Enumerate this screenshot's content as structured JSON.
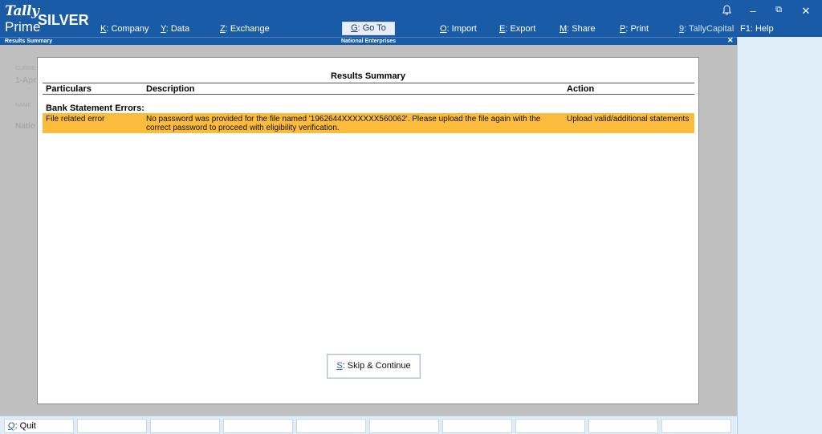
{
  "app": {
    "logo_top": "Tally",
    "logo_bottom": "Prime",
    "edition": "SILVER"
  },
  "menu": [
    {
      "key": "K",
      "label": ": Company"
    },
    {
      "key": "Y",
      "label": ": Data"
    },
    {
      "key": "Z",
      "label": ": Exchange"
    },
    {
      "key": "G",
      "label": ": Go To"
    },
    {
      "key": "O",
      "label": ": Import"
    },
    {
      "key": "E",
      "label": ": Export"
    },
    {
      "key": "M",
      "label": ": Share"
    },
    {
      "key": "P",
      "label": ": Print"
    },
    {
      "key": "9",
      "label": ": TallyCapital"
    },
    {
      "key": "F1",
      "label": ": Help"
    }
  ],
  "window_controls": {
    "bell": "bell-icon",
    "minimize": "–",
    "restore": "⧉",
    "close": "✕"
  },
  "strip": {
    "screen_title": "Results Summary",
    "company": "National Enterprises",
    "close": "✕"
  },
  "background_ghost": {
    "label1": "CURRE",
    "date": "1-Apr",
    "label2": "NAME",
    "company_partial": "Natio"
  },
  "modal": {
    "title": "Results Summary",
    "columns": {
      "particulars": "Particulars",
      "description": "Description",
      "action": "Action"
    },
    "section_heading": "Bank Statement Errors:",
    "rows": [
      {
        "particulars": "File related error",
        "description": "No password was provided for the file named '1962644XXXXXXX560062'. Please upload the file again with the correct password to proceed with eligibility verification.",
        "action": "Upload valid/additional statements"
      }
    ],
    "button": {
      "key": "S",
      "label": ": Skip & Continue"
    }
  },
  "bottombar": {
    "quit_key": "Q",
    "quit_label": ": Quit"
  },
  "colors": {
    "primary": "#1a5ba8",
    "highlight": "#fbbc3e",
    "panel": "#deedf8",
    "overlay": "#bfbfbf"
  }
}
